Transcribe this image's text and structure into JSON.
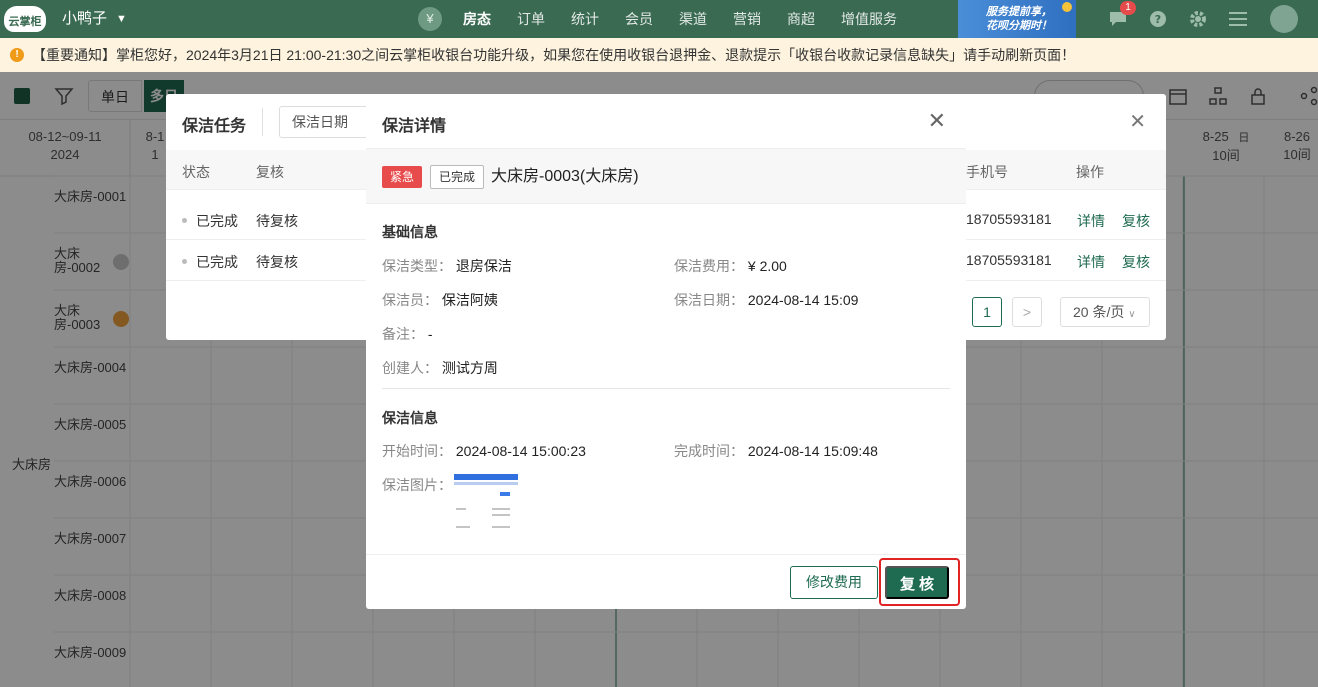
{
  "topnav": {
    "logo_text": "云掌柜",
    "hotel_name": "小鸭子",
    "menu": [
      "房态",
      "订单",
      "统计",
      "会员",
      "渠道",
      "营销",
      "商超",
      "增值服务"
    ],
    "active_menu": "房态",
    "ad_text_line1": "服务提前享，",
    "ad_text_line2": "花呗分期时！",
    "message_badge": "1"
  },
  "notice": {
    "text": "【重要通知】掌柜您好，2024年3月21日 21:00-21:30之间云掌柜收银台功能升级，如果您在使用收银台退押金、退款提示「收银台收款记录信息缺失」请手动刷新页面！"
  },
  "toolbar": {
    "single_day": "单日",
    "multi_day": "多日"
  },
  "calendar": {
    "range": "08-12~09-11",
    "year": "2024",
    "col_first": "8-1",
    "col_first_sub": "1",
    "col_825": "8-25",
    "col_825_sub": "10间",
    "col_825_dow": "日",
    "col_826": "8-26",
    "col_826_sub": "10间",
    "room_type": "大床房",
    "rooms": [
      "大床房-0001",
      "大床房-0002",
      "大床房-0003",
      "大床房-0004",
      "大床房-0005",
      "大床房-0006",
      "大床房-0007",
      "大床房-0008",
      "大床房-0009"
    ]
  },
  "task_dialog": {
    "title": "保洁任务",
    "date_filter": "保洁日期",
    "columns": {
      "status": "状态",
      "review": "复核",
      "phone": "手机号",
      "action": "操作"
    },
    "rows": [
      {
        "status": "已完成",
        "review": "待复核",
        "phone": "18705593181",
        "detail": "详情",
        "review_link": "复核"
      },
      {
        "status": "已完成",
        "review": "待复核",
        "phone": "18705593181",
        "detail": "详情",
        "review_link": "复核"
      }
    ],
    "pager": {
      "page": "1",
      "next": ">",
      "page_size": "20 条/页"
    }
  },
  "detail": {
    "title": "保洁详情",
    "tag_urgent": "紧急",
    "tag_status": "已完成",
    "room": "大床房-0003(大床房)",
    "basic": {
      "title": "基础信息",
      "type_label": "保洁类型：",
      "type_value": "退房保洁",
      "fee_label": "保洁费用：",
      "fee_value": "¥ 2.00",
      "cleaner_label": "保洁员：",
      "cleaner_value": "保洁阿姨",
      "date_label": "保洁日期：",
      "date_value": "2024-08-14 15:09",
      "remark_label": "备注：",
      "remark_value": "-",
      "creator_label": "创建人：",
      "creator_value": "测试方周"
    },
    "cleaning": {
      "title": "保洁信息",
      "start_label": "开始时间：",
      "start_value": "2024-08-14 15:00:23",
      "finish_label": "完成时间：",
      "finish_value": "2024-08-14 15:09:48",
      "image_label": "保洁图片："
    },
    "footer": {
      "edit_fee": "修改费用",
      "review": "复核"
    }
  },
  "colors": {
    "primary": "#1f6b52",
    "nav": "#3a6a52",
    "urgent": "#e84b4b",
    "highlight": "#e02424"
  }
}
